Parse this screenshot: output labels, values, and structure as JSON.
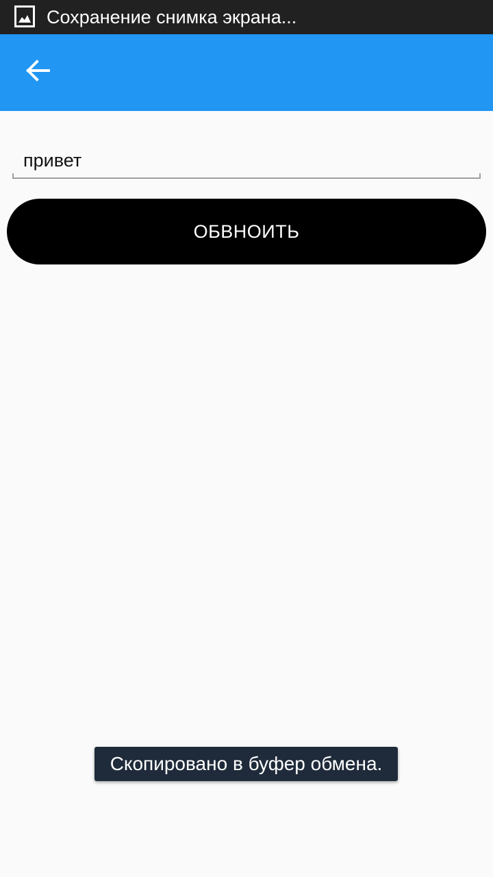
{
  "status_bar": {
    "notification_text": "Сохранение снимка экрана...",
    "icon": "image-icon",
    "background": "#212121"
  },
  "app_bar": {
    "back_icon": "arrow-left-icon",
    "background": "#2196f3"
  },
  "form": {
    "text_value": "привет",
    "text_placeholder": ""
  },
  "refresh_button": {
    "label": "ОБВНОИТЬ",
    "background": "#000000"
  },
  "toast": {
    "message": "Скопировано в буфер обмена."
  }
}
